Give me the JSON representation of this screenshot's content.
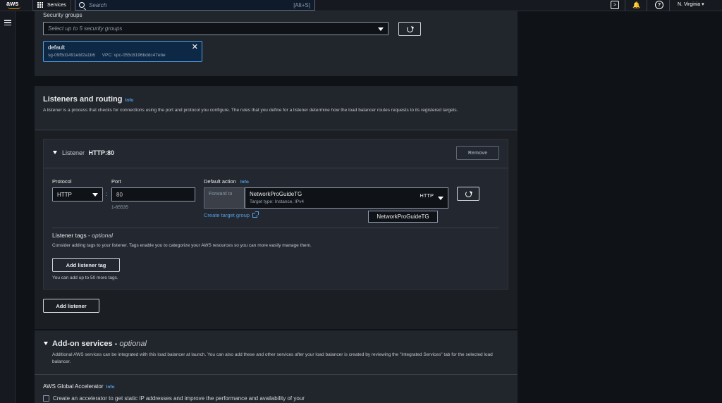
{
  "topbar": {
    "logo": "aws",
    "services_label": "Services",
    "search_placeholder": "Search",
    "search_shortcut": "[Alt+S]",
    "region": "N. Virginia ▾"
  },
  "security_groups": {
    "label": "Security groups",
    "placeholder": "Select up to 5 security groups",
    "token": {
      "name": "default",
      "id": "sg-09f5d1491ebf2a1b6",
      "vpc": "VPC: vpc-055c8196bddc47ebe"
    }
  },
  "listeners": {
    "title": "Listeners and routing",
    "info": "Info",
    "description": "A listener is a process that checks for connections using the port and protocol you configure. The rules that you define for a listener determine how the load balancer routes requests to its registered targets.",
    "listener": {
      "prefix": "Listener",
      "name": "HTTP:80",
      "remove_label": "Remove",
      "protocol_label": "Protocol",
      "protocol_value": "HTTP",
      "port_label": "Port",
      "port_value": "80",
      "port_hint": "1-65535",
      "default_action_label": "Default action",
      "forward_to": "Forward to",
      "target_group": "NetworkProGuideTG",
      "target_type": "Target type: Instance, IPv4",
      "target_protocol": "HTTP",
      "create_target_group": "Create target group",
      "tooltip": "NetworkProGuideTG",
      "tags_title": "Listener tags -",
      "tags_optional": "optional",
      "tags_description": "Consider adding tags to your listener. Tags enable you to categorize your AWS resources so you can more easily manage them.",
      "add_tag_label": "Add listener tag",
      "tags_hint": "You can add up to 50 more tags."
    },
    "add_listener_label": "Add listener"
  },
  "addon": {
    "title": "Add-on services -",
    "optional": "optional",
    "description": "Additional AWS services can be integrated with this load balancer at launch. You can also add these and other services after your load balancer is created by reviewing the \"Integrated Services\" tab for the selected load balancer.",
    "aga_title": "AWS Global Accelerator",
    "aga_info": "Info",
    "aga_checkbox_label": "Create an accelerator to get static IP addresses and improve the performance and availability of your"
  }
}
